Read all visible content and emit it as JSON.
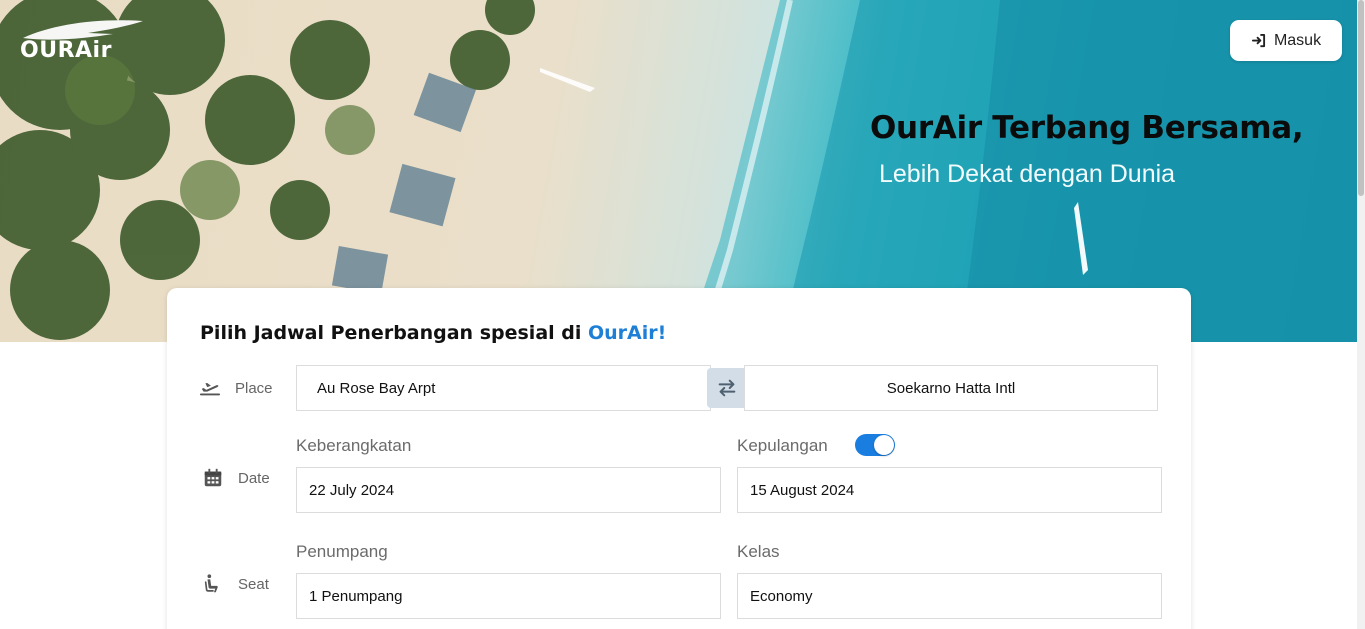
{
  "brand": {
    "logo_text": "OURAir"
  },
  "header": {
    "login_label": "Masuk",
    "hero_title": "OurAir Terbang Bersama,",
    "hero_subtitle": "Lebih Dekat dengan Dunia"
  },
  "search": {
    "title_prefix": "Pilih Jadwal Penerbangan spesial di ",
    "title_brand": "OurAir!",
    "place": {
      "label": "Place",
      "from": "Au Rose Bay Arpt",
      "to": "Soekarno Hatta Intl"
    },
    "date": {
      "label": "Date",
      "departure_label": "Keberangkatan",
      "departure_value": "22 July 2024",
      "return_label": "Kepulangan",
      "return_enabled": true,
      "return_value": "15 August 2024"
    },
    "seat": {
      "label": "Seat",
      "passenger_label": "Penumpang",
      "passenger_value": "1 Penumpang",
      "class_label": "Kelas",
      "class_value": "Economy"
    }
  },
  "colors": {
    "accent": "#1e7fd6",
    "toggle_on": "#1a7ee0",
    "swap_bg": "#d3dde8",
    "sea": "#19a2b4",
    "sand": "#eadfca"
  },
  "icons": {
    "login": "login-arrow-icon",
    "place": "plane-departure-icon",
    "swap": "swap-arrows-icon",
    "date": "calendar-icon",
    "seat": "seat-icon",
    "logo": "airplane-logo-icon"
  }
}
